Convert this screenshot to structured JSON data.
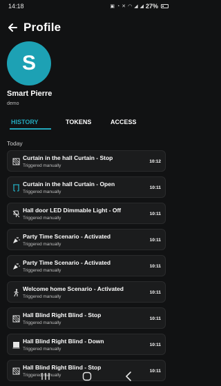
{
  "status_bar": {
    "time": "14:18",
    "battery": "27%"
  },
  "header": {
    "title": "Profile"
  },
  "user": {
    "avatar_letter": "S",
    "name": "Smart Pierre",
    "subtitle": "demo"
  },
  "tabs": [
    {
      "label": "HISTORY",
      "active": true
    },
    {
      "label": "TOKENS",
      "active": false
    },
    {
      "label": "ACCESS",
      "active": false
    }
  ],
  "section": {
    "label": "Today"
  },
  "history": [
    {
      "icon": "curtain-icon",
      "title": "Curtain in the hall Curtain - Stop",
      "subtitle": "Triggered manually",
      "time": "10:12",
      "icon_color": "#e6e6e6"
    },
    {
      "icon": "curtain-open-icon",
      "title": "Curtain in the hall Curtain - Open",
      "subtitle": "Triggered manually",
      "time": "10:11",
      "icon_color": "#23a9bd"
    },
    {
      "icon": "light-icon",
      "title": "Hall door LED Dimmable Light - Off",
      "subtitle": "Triggered manually",
      "time": "10:11",
      "icon_color": "#e6e6e6"
    },
    {
      "icon": "party-icon",
      "title": "Party Time Scenario - Activated",
      "subtitle": "Triggered manually",
      "time": "10:11",
      "icon_color": "#e6e6e6"
    },
    {
      "icon": "party-icon",
      "title": "Party Time Scenario - Activated",
      "subtitle": "Triggered manually",
      "time": "10:11",
      "icon_color": "#e6e6e6"
    },
    {
      "icon": "walking-icon",
      "title": "Welcome home Scenario - Activated",
      "subtitle": "Triggered manually",
      "time": "10:11",
      "icon_color": "#e6e6e6"
    },
    {
      "icon": "blind-icon",
      "title": "Hall Blind Right Blind - Stop",
      "subtitle": "Triggered manually",
      "time": "10:11",
      "icon_color": "#e6e6e6"
    },
    {
      "icon": "blind-down-icon",
      "title": "Hall Blind Right Blind - Down",
      "subtitle": "Triggered manually",
      "time": "10:11",
      "icon_color": "#e6e6e6"
    },
    {
      "icon": "blind-icon",
      "title": "Hall Blind Right Blind - Stop",
      "subtitle": "Triggered manually",
      "time": "10:11",
      "icon_color": "#e6e6e6"
    }
  ],
  "colors": {
    "accent": "#23a9bd",
    "avatar": "#1da1b4",
    "background": "#111213",
    "card": "#1b1c1d"
  }
}
